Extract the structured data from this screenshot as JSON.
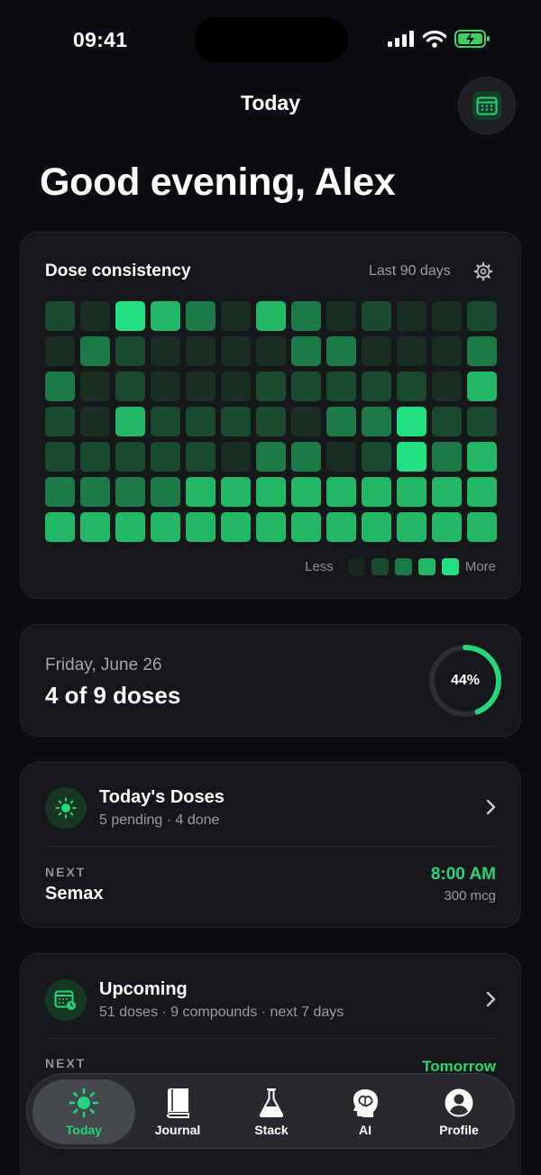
{
  "status": {
    "time": "09:41"
  },
  "header": {
    "title": "Today",
    "calendar_icon": "calendar-icon"
  },
  "greeting": "Good evening, Alex",
  "heatmap": {
    "title": "Dose consistency",
    "range": "Last 90 days",
    "rows": [
      [
        1,
        0,
        4,
        3,
        2,
        0,
        3,
        2,
        0,
        1,
        0,
        0,
        1
      ],
      [
        0,
        2,
        1,
        0,
        0,
        0,
        0,
        2,
        2,
        0,
        0,
        0,
        2
      ],
      [
        2,
        0,
        1,
        0,
        0,
        0,
        1,
        1,
        1,
        1,
        1,
        0,
        3
      ],
      [
        1,
        0,
        3,
        1,
        1,
        1,
        1,
        0,
        2,
        2,
        4,
        1,
        1
      ],
      [
        1,
        1,
        1,
        1,
        1,
        0,
        2,
        2,
        0,
        1,
        4,
        2,
        3
      ],
      [
        2,
        2,
        2,
        2,
        3,
        3,
        3,
        3,
        3,
        3,
        3,
        3,
        3
      ],
      [
        3,
        3,
        3,
        3,
        3,
        3,
        3,
        3,
        3,
        3,
        3,
        3,
        3
      ]
    ],
    "colors": [
      "#1a2d22",
      "#1a4a30",
      "#1d7a48",
      "#22b865",
      "#22e07f"
    ],
    "legend_less": "Less",
    "legend_more": "More",
    "legend_colors": [
      "#19261e",
      "#1a4a30",
      "#1d7a48",
      "#22b865",
      "#22e07f"
    ]
  },
  "day": {
    "date": "Friday, June 26",
    "count": "4 of 9 doses",
    "progress_percent": 44,
    "progress_label": "44%",
    "accent": "#23d77a"
  },
  "todays_doses": {
    "title": "Today's Doses",
    "subtitle": "5 pending · 4 done",
    "icon": "sun-icon",
    "next_label": "NEXT",
    "next_name": "Semax",
    "next_time": "8:00 AM",
    "next_amount": "300 mcg"
  },
  "upcoming": {
    "title": "Upcoming",
    "subtitle": "51 doses · 9 compounds · next 7 days",
    "icon": "calendar-clock-icon",
    "next_label": "NEXT",
    "next_time": "Tomorrow"
  },
  "tabs": [
    {
      "label": "Today",
      "icon": "sun-icon",
      "active": true
    },
    {
      "label": "Journal",
      "icon": "book-icon",
      "active": false
    },
    {
      "label": "Stack",
      "icon": "flask-icon",
      "active": false
    },
    {
      "label": "AI",
      "icon": "brain-icon",
      "active": false
    },
    {
      "label": "Profile",
      "icon": "profile-icon",
      "active": false
    }
  ]
}
